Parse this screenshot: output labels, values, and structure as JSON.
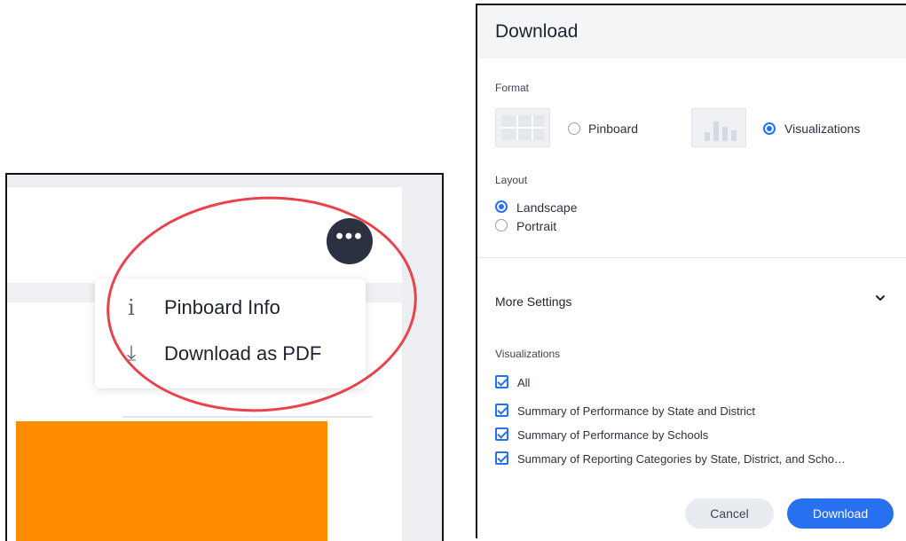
{
  "left_screenshot": {
    "more_button_label": "•••",
    "menu": {
      "items": [
        {
          "label": "Pinboard Info",
          "icon": "info-icon",
          "glyph": "i"
        },
        {
          "label": "Download as PDF",
          "icon": "download-icon",
          "glyph": "⤓"
        }
      ]
    },
    "highlight_color": "#e8434c",
    "chart_color": "#ff8c00"
  },
  "dialog": {
    "title": "Download",
    "format": {
      "label": "Format",
      "options": [
        {
          "label": "Pinboard",
          "selected": false
        },
        {
          "label": "Visualizations",
          "selected": true
        }
      ]
    },
    "layout": {
      "label": "Layout",
      "options": [
        {
          "label": "Landscape",
          "selected": true
        },
        {
          "label": "Portrait",
          "selected": false
        }
      ]
    },
    "more_settings": {
      "label": "More Settings",
      "expanded": true
    },
    "visualizations": {
      "label": "Visualizations",
      "items": [
        {
          "label": "All",
          "checked": true
        },
        {
          "label": "Summary of Performance by State and District",
          "checked": true
        },
        {
          "label": "Summary of Performance by Schools",
          "checked": true
        },
        {
          "label": "Summary of Reporting Categories by State, District, and Scho…",
          "checked": true
        }
      ]
    },
    "buttons": {
      "cancel": "Cancel",
      "download": "Download"
    },
    "accent_color": "#2770ef"
  }
}
